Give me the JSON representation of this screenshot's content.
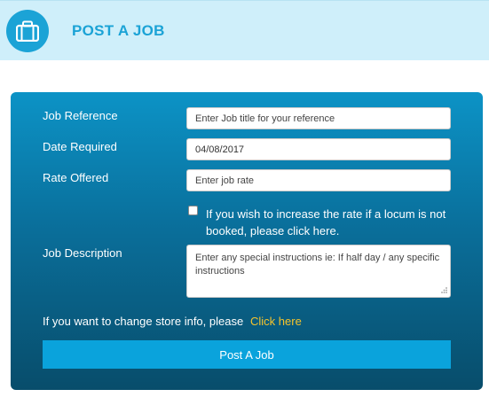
{
  "header": {
    "title": "POST A JOB",
    "icon": "briefcase-icon"
  },
  "form": {
    "job_reference": {
      "label": "Job Reference",
      "placeholder": "Enter Job title for your reference",
      "value": ""
    },
    "date_required": {
      "label": "Date Required",
      "value": "04/08/2017"
    },
    "rate_offered": {
      "label": "Rate Offered",
      "placeholder": "Enter job rate",
      "value": ""
    },
    "rate_checkbox": {
      "label": "If you wish to increase the rate if a locum is not booked, please click here.",
      "checked": false
    },
    "job_description": {
      "label": "Job Description",
      "placeholder": "Enter any special instructions ie: If half day / any specific instructions",
      "value": ""
    },
    "store_info": {
      "text": "If you want to change store info, please",
      "link": "Click here"
    },
    "submit_label": "Post A Job"
  },
  "colors": {
    "header_bg": "#cfeffa",
    "accent": "#1ba3d6",
    "link": "#f5c32c",
    "button": "#0aa3dc"
  }
}
